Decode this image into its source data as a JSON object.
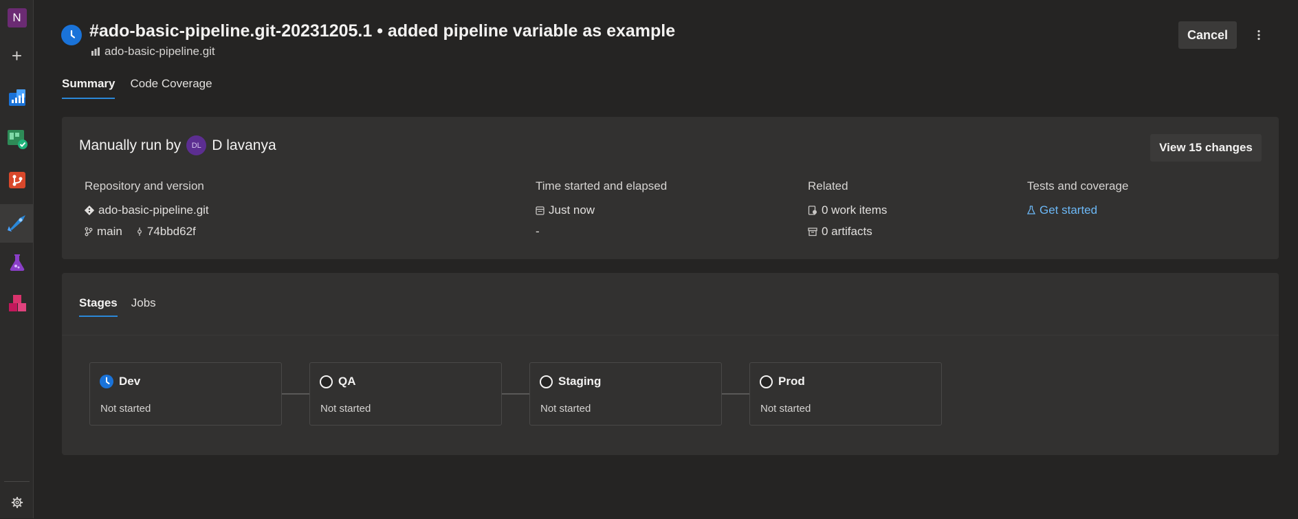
{
  "rail": {
    "org_initial": "N",
    "items": [
      {
        "icon": "plus-icon"
      },
      {
        "icon": "overview-icon",
        "color": "#1a73d9"
      },
      {
        "icon": "boards-icon",
        "color": "#2ea44f"
      },
      {
        "icon": "repos-icon",
        "color": "#e0542e"
      },
      {
        "icon": "pipelines-icon",
        "color": "#2b88d8",
        "active": true
      },
      {
        "icon": "test-plans-icon",
        "color": "#8a3fc7"
      },
      {
        "icon": "artifacts-icon",
        "color": "#d9336c"
      },
      {
        "icon": "settings-icon"
      }
    ]
  },
  "header": {
    "title": "#ado-basic-pipeline.git-20231205.1 • added pipeline variable as example",
    "repo": "ado-basic-pipeline.git",
    "cancel_label": "Cancel"
  },
  "tabs": [
    {
      "label": "Summary",
      "active": true
    },
    {
      "label": "Code Coverage",
      "active": false
    }
  ],
  "summary": {
    "manual_prefix": "Manually run by",
    "avatar_initials": "DL",
    "user_name": "D lavanya",
    "view_changes_label": "View 15 changes",
    "repository": {
      "label": "Repository and version",
      "name": "ado-basic-pipeline.git",
      "branch": "main",
      "commit": "74bbd62f"
    },
    "time": {
      "label": "Time started and elapsed",
      "started": "Just now",
      "elapsed": "-"
    },
    "related": {
      "label": "Related",
      "work_items": "0 work items",
      "artifacts": "0 artifacts"
    },
    "tests": {
      "label": "Tests and coverage",
      "link": "Get started"
    }
  },
  "stages_card": {
    "tabs": [
      {
        "label": "Stages",
        "active": true
      },
      {
        "label": "Jobs",
        "active": false
      }
    ],
    "stages": [
      {
        "name": "Dev",
        "status": "Not started",
        "state": "running"
      },
      {
        "name": "QA",
        "status": "Not started",
        "state": "pending"
      },
      {
        "name": "Staging",
        "status": "Not started",
        "state": "pending"
      },
      {
        "name": "Prod",
        "status": "Not started",
        "state": "pending"
      }
    ]
  }
}
